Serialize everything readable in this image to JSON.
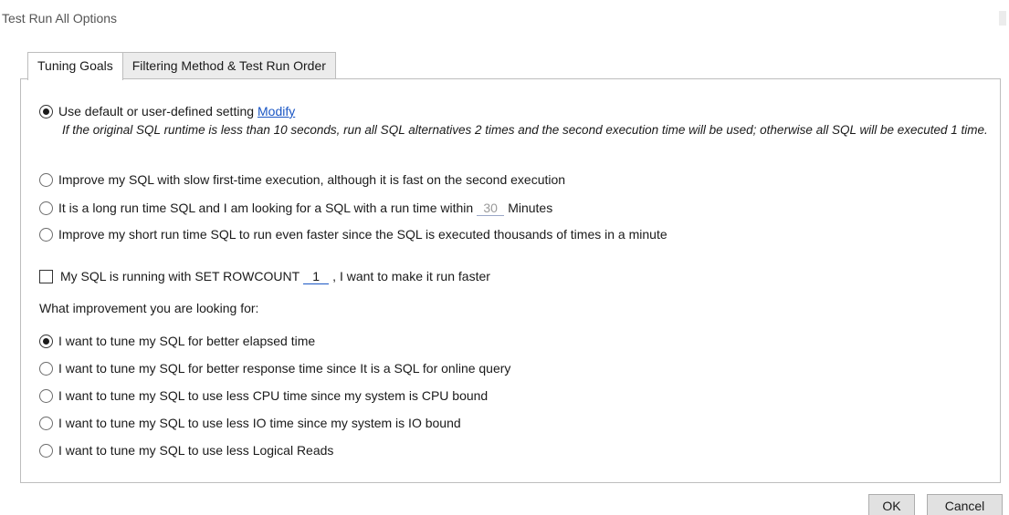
{
  "window": {
    "title": "Test Run All Options"
  },
  "tabs": [
    {
      "label": "Tuning Goals",
      "active": true
    },
    {
      "label": "Filtering Method & Test Run Order",
      "active": false
    }
  ],
  "run_options": {
    "default": {
      "label": "Use default or user-defined setting",
      "link": "Modify",
      "note": "If the original SQL runtime is less than 10 seconds, run all SQL alternatives 2 times and the second execution time will be used; otherwise all SQL will be executed 1 time.",
      "checked": true
    },
    "slow_first": {
      "label": "Improve my SQL with slow first-time execution, although it is fast on the second execution",
      "checked": false
    },
    "long_run": {
      "label_before": "It is a long run time SQL and I am looking for a SQL with a run time within",
      "value": "30",
      "label_after": "Minutes",
      "checked": false
    },
    "short_run": {
      "label": "Improve my short run time SQL to run even faster since the SQL is executed thousands of times in a minute",
      "checked": false
    }
  },
  "rowcount": {
    "label_before": "My SQL is running with SET ROWCOUNT",
    "value": "1",
    "label_after": ", I want to make it run faster",
    "checked": false
  },
  "improvement": {
    "heading": "What improvement you are looking for:",
    "options": [
      {
        "label": "I want to tune my SQL for better elapsed time",
        "checked": true
      },
      {
        "label": "I want to tune my SQL for better response time since It is a SQL for online query",
        "checked": false
      },
      {
        "label": "I want to tune my SQL to use less CPU time since my system is CPU bound",
        "checked": false
      },
      {
        "label": "I want to tune my SQL to use less IO time since my system is IO bound",
        "checked": false
      },
      {
        "label": "I want to tune my SQL to use less Logical Reads",
        "checked": false
      }
    ]
  },
  "buttons": {
    "ok": "OK",
    "cancel": "Cancel"
  }
}
